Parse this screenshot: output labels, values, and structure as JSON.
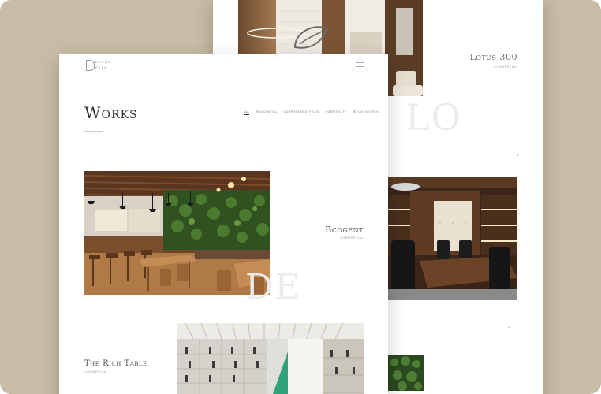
{
  "back_page": {
    "project_title": "Lotus 300",
    "project_category": "Commercial",
    "watermark": "LO"
  },
  "front_page": {
    "logo_line1": "DEVAN",
    "logo_line2": "PALE",
    "section_title": "Works",
    "filters": [
      "All",
      "Residential",
      "Corporate Offices",
      "Hospitality",
      "Retail Stores"
    ],
    "projects": [
      {
        "title": "Bcogent",
        "category": "Commercial",
        "watermark": "DE"
      },
      {
        "title": "The Rich Table",
        "category": "Commercial"
      }
    ]
  },
  "colors": {
    "background": "#c9bca6",
    "page": "#ffffff",
    "text": "#555555",
    "wood": "#8a5a2e",
    "greenery": "#3f6b2c",
    "leather": "#1c1c1c"
  },
  "icons": [
    "menu-icon",
    "logo-mark-icon"
  ]
}
